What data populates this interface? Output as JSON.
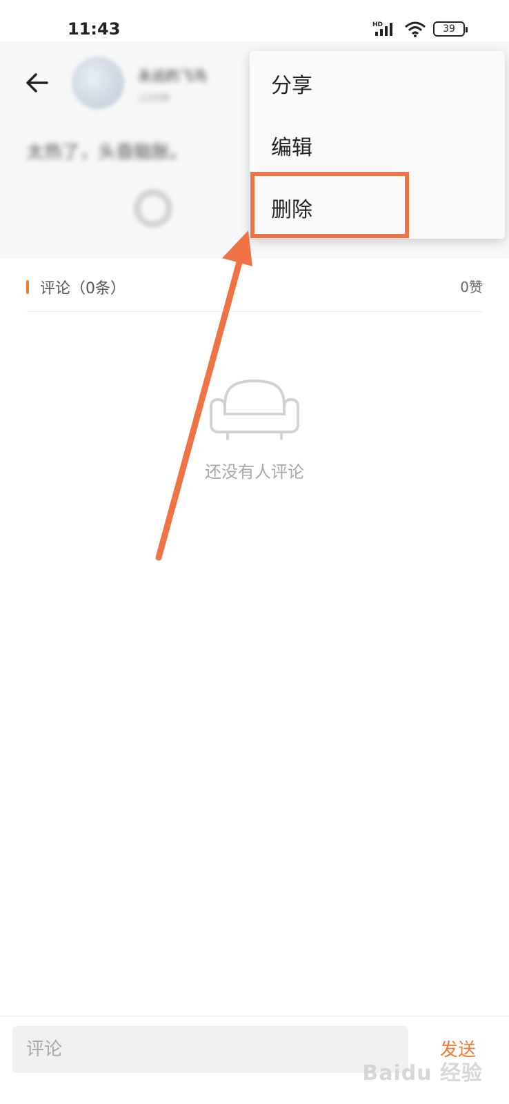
{
  "status_bar": {
    "time": "11:43",
    "battery": "39"
  },
  "post": {
    "author_name": "永远的飞鸟",
    "author_sub": "12分钟",
    "text": "太热了，头昏脑胀。"
  },
  "menu": {
    "items": [
      "分享",
      "编辑",
      "删除"
    ]
  },
  "comments": {
    "title": "评论（0条）",
    "likes": "0赞",
    "empty_text": "还没有人评论"
  },
  "bottom": {
    "input_placeholder": "评论",
    "send_label": "发送"
  },
  "watermark": {
    "text": "Baidu 经验"
  },
  "colors": {
    "accent": "#f07a33",
    "highlight": "#f07345"
  }
}
